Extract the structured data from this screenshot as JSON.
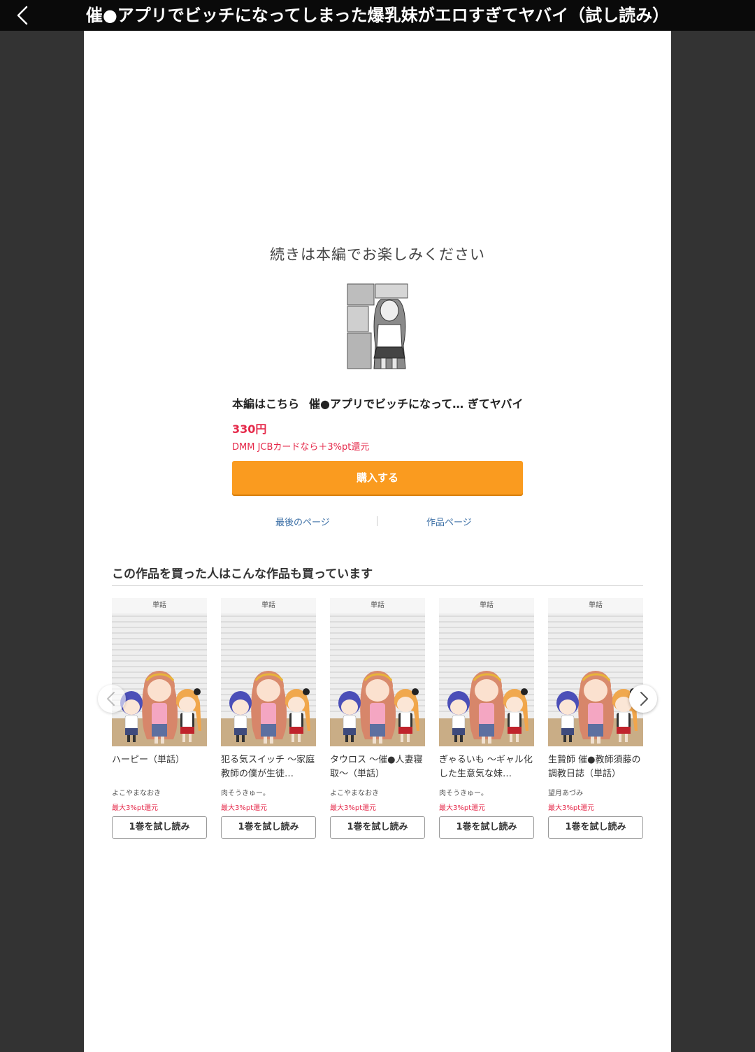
{
  "header": {
    "back_icon": "chevron-left-icon",
    "title": "催●アプリでビッチになってしまった爆乳妹がエロすぎてヤバイ（試し読み）"
  },
  "end_panel": {
    "continue_message": "続きは本編でお楽しみください",
    "main_label": "本編はこちら",
    "main_title": "催●アプリでビッチになって… ぎてヤバイ",
    "price": "330円",
    "point_note": "DMM JCBカードなら＋3%pt還元",
    "buy_label": "購入する",
    "last_page_link": "最後のページ",
    "work_page_link": "作品ページ"
  },
  "recommendations": {
    "heading": "この作品を買った人はこんな作品も買っています",
    "prev_icon": "chevron-left-icon",
    "next_icon": "chevron-right-icon",
    "items": [
      {
        "label": "単話",
        "title": "ハーピー（単話）",
        "author": "よこやまなおき",
        "point": "最大3%pt還元",
        "button": "1巻を試し読み"
      },
      {
        "label": "単話",
        "title": "犯る気スイッチ 〜家庭教師の僕が生徒…",
        "author": "肉そうきゅー。",
        "point": "最大3%pt還元",
        "button": "1巻を試し読み"
      },
      {
        "label": "単話",
        "title": "タウロス 〜催●人妻寝取〜（単話）",
        "author": "よこやまなおき",
        "point": "最大3%pt還元",
        "button": "1巻を試し読み"
      },
      {
        "label": "単話",
        "title": "ぎゃるいも 〜ギャル化した生意気な妹…",
        "author": "肉そうきゅー。",
        "point": "最大3%pt還元",
        "button": "1巻を試し読み"
      },
      {
        "label": "単話",
        "title": "生贄師 催●教師須藤の調教日誌（単話）",
        "author": "望月あづみ",
        "point": "最大3%pt還元",
        "button": "1巻を試し読み"
      }
    ]
  },
  "colors": {
    "accent_orange": "#fa9b1f",
    "price_red": "#e5294a",
    "link_blue": "#3a6ea5"
  }
}
